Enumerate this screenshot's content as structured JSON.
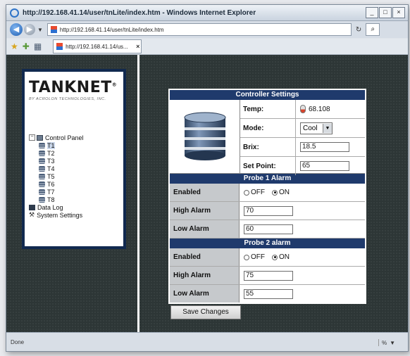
{
  "browser": {
    "title": "http://192.168.41.14/user/tnLite/index.htm - Windows Internet Explorer",
    "address": "http://192.168.41.14/user/tnLite/index.htm",
    "tab_title": "http://192.168.41.14/us...",
    "status_text": "Done",
    "zoom": "%"
  },
  "logo": {
    "name": "TANKNET",
    "tagline": "BY ACROLON TECHNOLOGIES, INC."
  },
  "nav": {
    "root": "Control Panel",
    "tanks": [
      "T1",
      "T2",
      "T3",
      "T4",
      "T5",
      "T6",
      "T7",
      "T8"
    ],
    "selected": "T1",
    "items": [
      "Data Log",
      "System Settings"
    ]
  },
  "controller": {
    "header": "Controller Settings",
    "temp_label": "Temp:",
    "temp_value": "68.108",
    "mode_label": "Mode:",
    "mode_value": "Cool",
    "brix_label": "Brix:",
    "brix_value": "18.5",
    "setpoint_label": "Set Point:",
    "setpoint_value": "65"
  },
  "probe1": {
    "header": "Probe 1 Alarm",
    "enabled_label": "Enabled",
    "off_label": "OFF",
    "on_label": "ON",
    "enabled": "ON",
    "high_label": "High Alarm",
    "high_value": "70",
    "low_label": "Low Alarm",
    "low_value": "60"
  },
  "probe2": {
    "header": "Probe 2 alarm",
    "enabled_label": "Enabled",
    "off_label": "OFF",
    "on_label": "ON",
    "enabled": "ON",
    "high_label": "High Alarm",
    "high_value": "75",
    "low_label": "Low Alarm",
    "low_value": "55"
  },
  "save_label": "Save Changes"
}
